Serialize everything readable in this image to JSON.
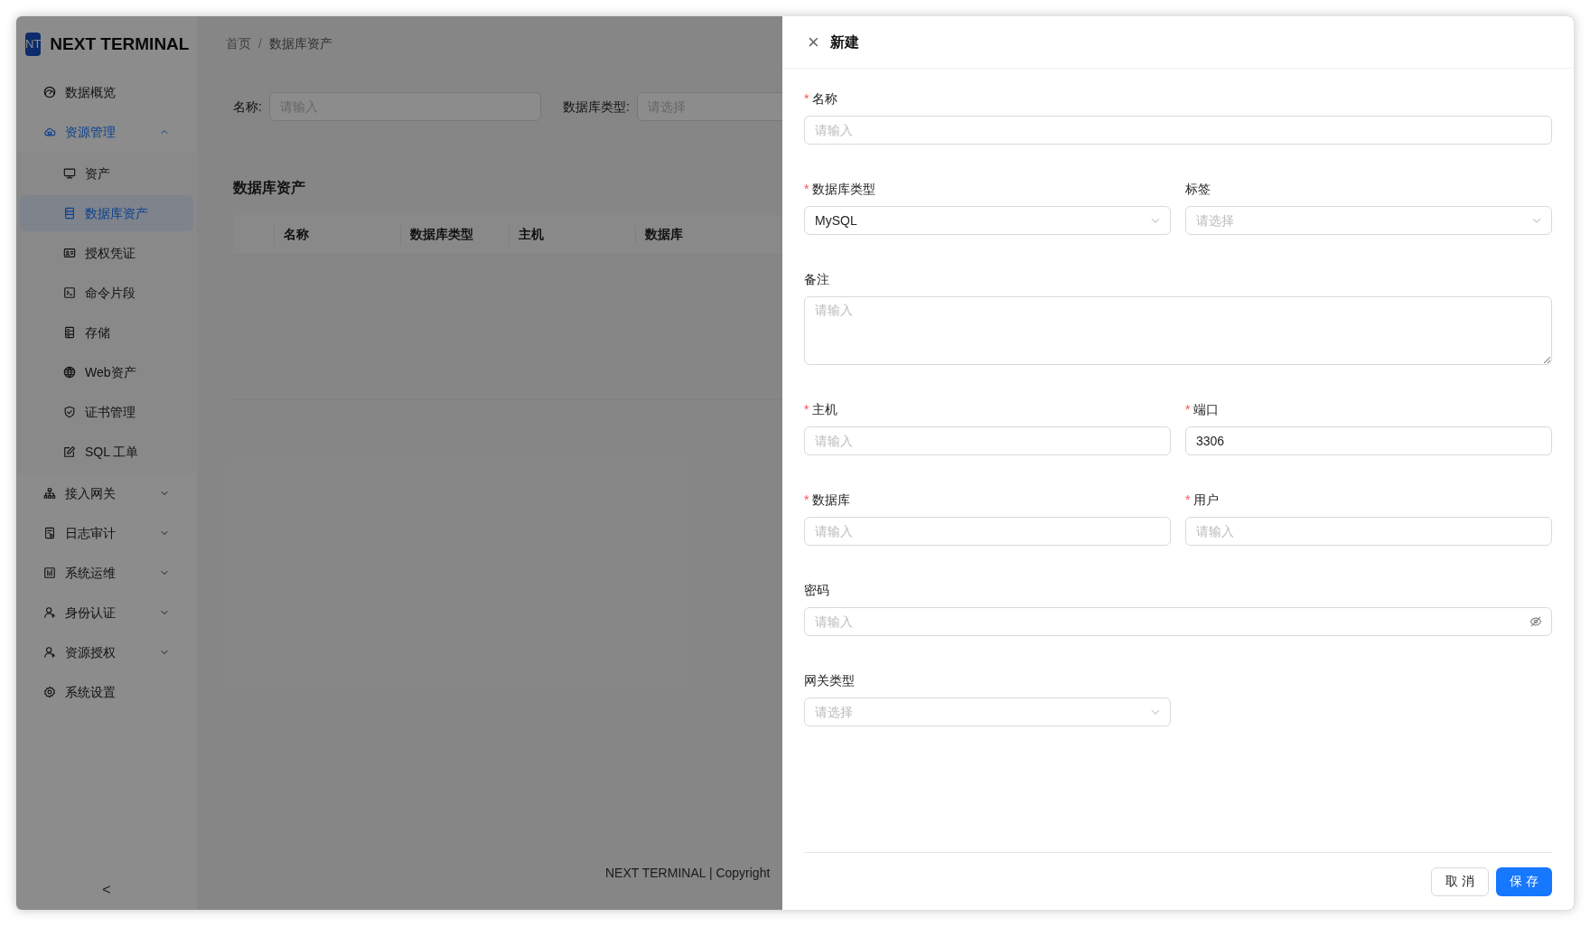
{
  "logo": {
    "badge": "NT",
    "title": "NEXT TERMINAL"
  },
  "sidebar": {
    "items": [
      {
        "label": "数据概览",
        "selected": false
      },
      {
        "label": "资源管理",
        "selected": false,
        "expanded": true,
        "children": [
          {
            "label": "资产",
            "selected": false
          },
          {
            "label": "数据库资产",
            "selected": true
          },
          {
            "label": "授权凭证",
            "selected": false
          },
          {
            "label": "命令片段",
            "selected": false
          },
          {
            "label": "存储",
            "selected": false
          },
          {
            "label": "Web资产",
            "selected": false
          },
          {
            "label": "证书管理",
            "selected": false
          },
          {
            "label": "SQL 工单",
            "selected": false
          }
        ]
      },
      {
        "label": "接入网关",
        "selected": false,
        "expanded": false
      },
      {
        "label": "日志审计",
        "selected": false,
        "expanded": false
      },
      {
        "label": "系统运维",
        "selected": false,
        "expanded": false
      },
      {
        "label": "身份认证",
        "selected": false,
        "expanded": false
      },
      {
        "label": "资源授权",
        "selected": false,
        "expanded": false
      },
      {
        "label": "系统设置",
        "selected": false
      }
    ],
    "collapse": "<"
  },
  "breadcrumb": {
    "items": [
      "首页",
      "数据库资产"
    ],
    "separator": "/"
  },
  "filters": [
    {
      "label": "名称:",
      "placeholder": "请输入"
    },
    {
      "label": "数据库类型:",
      "placeholder": "请选择"
    }
  ],
  "table": {
    "title": "数据库资产",
    "columns": [
      "名称",
      "数据库类型",
      "主机",
      "数据库"
    ]
  },
  "footer": "NEXT TERMINAL | Copyright",
  "drawer": {
    "title": "新建",
    "close": "×",
    "fields": [
      {
        "kind": "input",
        "label": "名称",
        "required_mark": "*",
        "wide": true,
        "placeholder": "请输入"
      },
      {
        "kind": "select",
        "label": "数据库类型",
        "required_mark": "*",
        "wide": false,
        "value": "MySQL"
      },
      {
        "kind": "select",
        "label": "标签",
        "wide": false,
        "placeholder": "请选择"
      },
      {
        "kind": "textarea",
        "label": "备注",
        "wide": true,
        "placeholder": "请输入"
      },
      {
        "kind": "input",
        "label": "主机",
        "required_mark": "*",
        "wide": false,
        "placeholder": "请输入"
      },
      {
        "kind": "input",
        "label": "端口",
        "required_mark": "*",
        "wide": false,
        "value": "3306"
      },
      {
        "kind": "input",
        "label": "数据库",
        "required_mark": "*",
        "wide": false,
        "placeholder": "请输入"
      },
      {
        "kind": "input",
        "label": "用户",
        "required_mark": "*",
        "wide": false,
        "placeholder": "请输入"
      },
      {
        "kind": "password",
        "label": "密码",
        "wide": true,
        "placeholder": "请输入"
      },
      {
        "kind": "select",
        "label": "网关类型",
        "wide": false,
        "placeholder": "请选择"
      }
    ],
    "buttons": [
      {
        "label": "取 消",
        "primary": false
      },
      {
        "label": "保 存",
        "primary": true
      }
    ]
  }
}
